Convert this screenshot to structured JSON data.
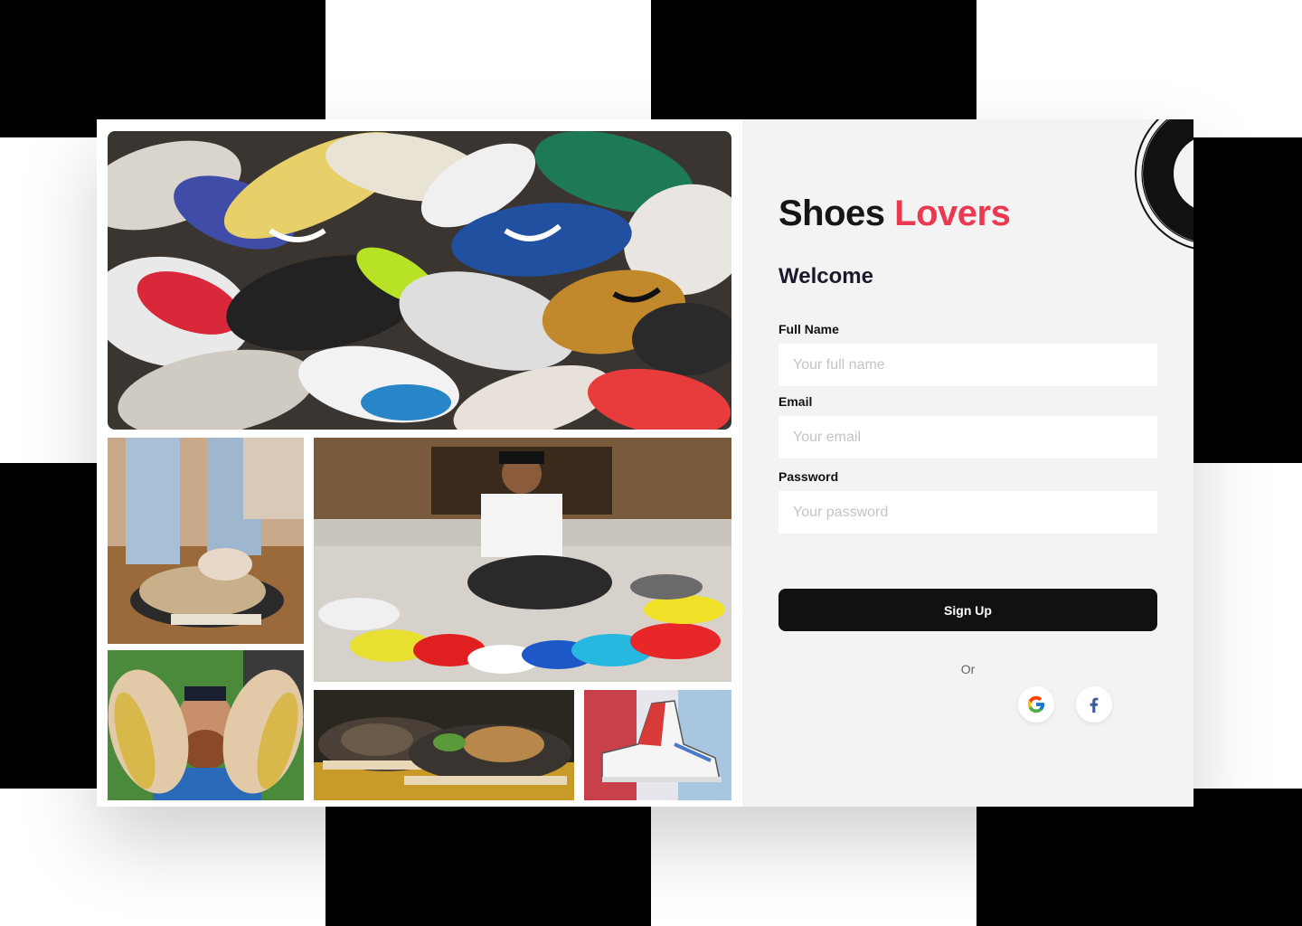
{
  "brand": {
    "title_part1": "Shoes",
    "title_part2": "Lovers"
  },
  "form": {
    "heading": "Welcome",
    "fields": [
      {
        "label": "Full Name",
        "placeholder": "Your full name",
        "value": ""
      },
      {
        "label": "Email",
        "placeholder": "Your email",
        "value": ""
      },
      {
        "label": "Password",
        "placeholder": "Your password",
        "value": ""
      }
    ],
    "submit_label": "Sign Up",
    "divider_text": "Or",
    "social": [
      {
        "name": "google-icon"
      },
      {
        "name": "facebook-icon"
      }
    ]
  },
  "colors": {
    "accent": "#ea3a52",
    "button": "#111111",
    "panel_bg": "#f3f3f3",
    "facebook": "#3b5998"
  },
  "gallery": {
    "photos": [
      "sneaker-pile-photo",
      "tying-sneakers-photo",
      "man-on-bed-with-sneakers-photo",
      "man-holding-sneakers-photo",
      "sneaker-pair-closeup-photo",
      "sneaker-illustration-photo"
    ]
  }
}
